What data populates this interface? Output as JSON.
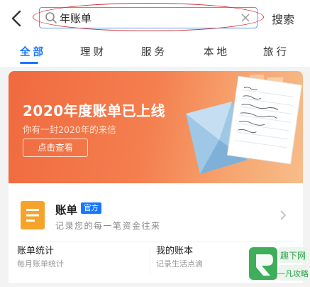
{
  "search": {
    "value": "年账单",
    "button_label": "搜索"
  },
  "tabs": [
    {
      "label": "全部",
      "active": true
    },
    {
      "label": "理财",
      "active": false
    },
    {
      "label": "服务",
      "active": false
    },
    {
      "label": "本地",
      "active": false
    },
    {
      "label": "旅行",
      "active": false
    }
  ],
  "banner": {
    "title": "2020年度账单已上线",
    "subtitle": "你有一封2020年的来信",
    "button_label": "点击查看"
  },
  "result": {
    "name": "账单",
    "badge": "官方",
    "description": "记录您的每一笔资金往来",
    "sub_items": [
      {
        "title": "账单统计",
        "desc": "每月账单统计"
      },
      {
        "title": "我的账本",
        "desc": "记录生活点滴"
      }
    ]
  },
  "watermark": {
    "line1": "趣下网",
    "line2": "一凡攻略"
  },
  "colors": {
    "accent": "#1677ff",
    "banner": "#f47f4f",
    "annotation": "#d0313b",
    "app_icon": "#f6a32c"
  }
}
